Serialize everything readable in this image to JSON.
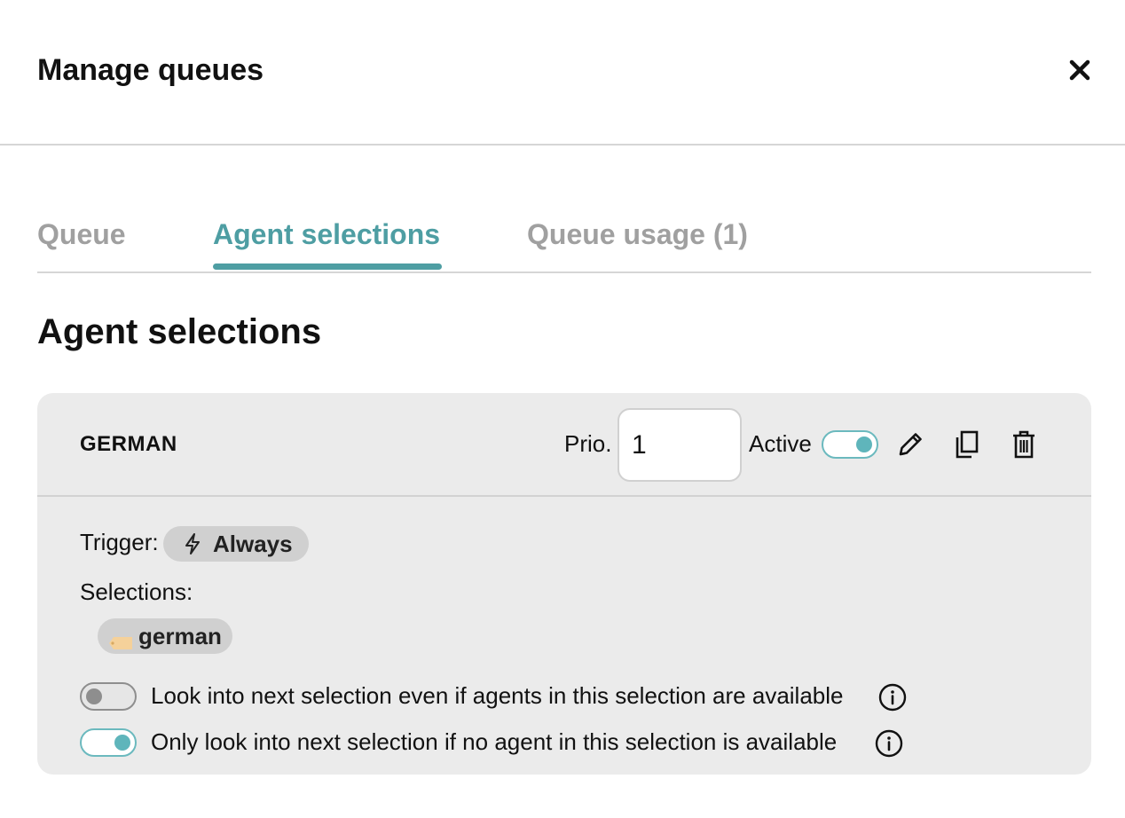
{
  "dialog": {
    "title": "Manage queues",
    "close_icon": "close-icon"
  },
  "tabs": [
    {
      "label": "Queue",
      "active": false
    },
    {
      "label": "Agent selections",
      "active": true
    },
    {
      "label": "Queue usage (1)",
      "active": false
    }
  ],
  "section_title": "Agent selections",
  "selection_card": {
    "name": "GERMAN",
    "prio_label": "Prio.",
    "prio_value": "1",
    "active_label": "Active",
    "active": true,
    "actions": [
      "pencil-icon",
      "copy-icon",
      "trash-icon"
    ],
    "trigger_label": "Trigger:",
    "trigger_value": "Always",
    "trigger_icon": "lightning-icon",
    "selections_label": "Selections:",
    "selections": [
      {
        "label": "german",
        "icon": "tag-icon",
        "tag_color": "#f5d19a"
      }
    ],
    "options": [
      {
        "text": "Look into next selection even if agents in this selection are available",
        "enabled": false
      },
      {
        "text": "Only look into next selection if no agent in this selection is available",
        "enabled": true
      }
    ]
  },
  "colors": {
    "accent": "#4e9ea3",
    "toggle_on": "#5fb5bb",
    "card_bg": "#ebebeb",
    "chip_bg": "#d0d0d0"
  }
}
